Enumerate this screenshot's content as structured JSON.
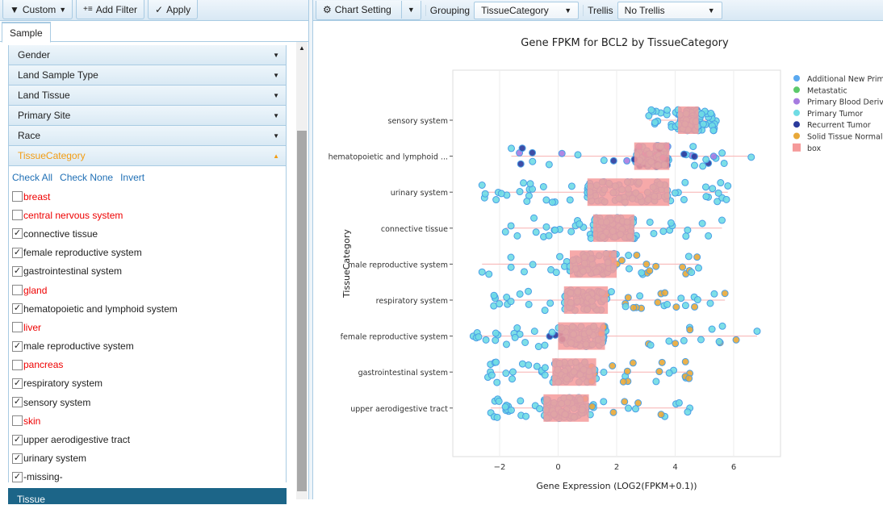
{
  "left": {
    "toolbar": {
      "custom": "Custom",
      "add_filter": "Add Filter",
      "apply": "Apply"
    },
    "tab": "Sample",
    "sections": [
      "Gender",
      "Land Sample Type",
      "Land Tissue",
      "Primary Site",
      "Race"
    ],
    "active_section": "TissueCategory",
    "links": {
      "check_all": "Check All",
      "check_none": "Check None",
      "invert": "Invert"
    },
    "items": [
      {
        "label": "breast",
        "checked": false
      },
      {
        "label": "central nervous system",
        "checked": false
      },
      {
        "label": "connective tissue",
        "checked": true
      },
      {
        "label": "female reproductive system",
        "checked": true
      },
      {
        "label": "gastrointestinal system",
        "checked": true
      },
      {
        "label": "gland",
        "checked": false
      },
      {
        "label": "hematopoietic and lymphoid system",
        "checked": true
      },
      {
        "label": "liver",
        "checked": false
      },
      {
        "label": "male reproductive system",
        "checked": true
      },
      {
        "label": "pancreas",
        "checked": false
      },
      {
        "label": "respiratory system",
        "checked": true
      },
      {
        "label": "sensory system",
        "checked": true
      },
      {
        "label": "skin",
        "checked": false
      },
      {
        "label": "upper aerodigestive tract",
        "checked": true
      },
      {
        "label": "urinary system",
        "checked": true
      },
      {
        "label": "-missing-",
        "checked": true
      }
    ],
    "next_section": "Tissue"
  },
  "right": {
    "toolbar": {
      "chart_setting": "Chart Setting",
      "grouping_label": "Grouping",
      "grouping_value": "TissueCategory",
      "trellis_label": "Trellis",
      "trellis_value": "No Trellis"
    }
  },
  "chart_data": {
    "type": "scatter",
    "title": "Gene FPKM for BCL2 by TissueCategory",
    "xlabel": "Gene Expression (LOG2(FPKM+0.1))",
    "ylabel": "TissueCategory",
    "xlim": [
      -3.6,
      7.6
    ],
    "xticks": [
      "−2",
      "0",
      "2",
      "4",
      "6"
    ],
    "xtick_values": [
      -2,
      0,
      2,
      4,
      6
    ],
    "grid": true,
    "legend_position": "right",
    "legend": [
      {
        "name": "Additional New Prima",
        "color": "#5aa9f0"
      },
      {
        "name": "Metastatic",
        "color": "#5cc96b"
      },
      {
        "name": "Primary Blood Derive",
        "color": "#a67be0"
      },
      {
        "name": "Primary Tumor",
        "color": "#6fdce4"
      },
      {
        "name": "Recurrent Tumor",
        "color": "#2a3a9c"
      },
      {
        "name": "Solid Tissue Normal",
        "color": "#e8a838"
      },
      {
        "name": "box",
        "color": "#f59a9a"
      }
    ],
    "categories": [
      {
        "name": "sensory system",
        "min": 3.1,
        "q1": 4.1,
        "q3": 4.8,
        "max": 5.4,
        "normal": false
      },
      {
        "name": "hematopoietic and lymphoid ...",
        "min": -1.6,
        "q1": 2.6,
        "q3": 3.8,
        "max": 6.6,
        "normal": false
      },
      {
        "name": "urinary system",
        "min": -2.6,
        "q1": 1.0,
        "q3": 3.8,
        "max": 5.8,
        "normal": false
      },
      {
        "name": "connective tissue",
        "min": -1.8,
        "q1": 1.2,
        "q3": 2.6,
        "max": 5.6,
        "normal": false
      },
      {
        "name": "male reproductive system",
        "min": -2.6,
        "q1": 0.4,
        "q3": 2.0,
        "max": 4.8,
        "normal": true
      },
      {
        "name": "respiratory system",
        "min": -2.2,
        "q1": 0.2,
        "q3": 1.7,
        "max": 5.7,
        "normal": true
      },
      {
        "name": "female reproductive system",
        "min": -2.9,
        "q1": 0.0,
        "q3": 1.6,
        "max": 6.8,
        "normal": true
      },
      {
        "name": "gastrointestinal system",
        "min": -2.4,
        "q1": -0.2,
        "q3": 1.3,
        "max": 4.5,
        "normal": true
      },
      {
        "name": "upper aerodigestive tract",
        "min": -2.3,
        "q1": -0.5,
        "q3": 1.05,
        "max": 4.5,
        "normal": true
      }
    ]
  }
}
